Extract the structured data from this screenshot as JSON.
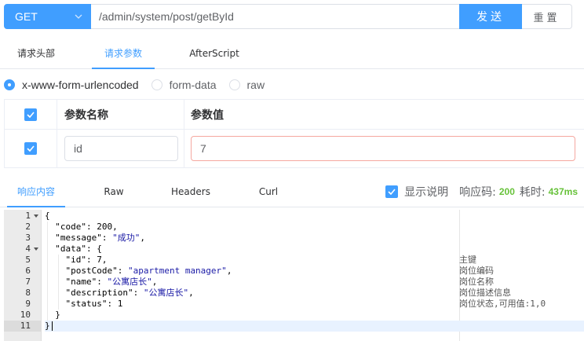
{
  "request": {
    "method": "GET",
    "url": "/admin/system/post/getById",
    "send_label": "发送",
    "reset_label": "重置"
  },
  "request_tabs": [
    {
      "label": "请求头部",
      "active": false
    },
    {
      "label": "请求参数",
      "active": true
    },
    {
      "label": "AfterScript",
      "active": false
    }
  ],
  "content_types": [
    {
      "label": "x-www-form-urlencoded",
      "checked": true
    },
    {
      "label": "form-data",
      "checked": false
    },
    {
      "label": "raw",
      "checked": false
    }
  ],
  "params_table": {
    "headers": [
      "参数名称",
      "参数值"
    ],
    "rows": [
      {
        "checked": true,
        "name": "id",
        "value": "7"
      }
    ]
  },
  "response_tabs": [
    {
      "label": "响应内容",
      "active": true
    },
    {
      "label": "Raw",
      "active": false
    },
    {
      "label": "Headers",
      "active": false
    },
    {
      "label": "Curl",
      "active": false
    }
  ],
  "response_meta": {
    "show_description_label": "显示说明",
    "show_description_checked": true,
    "status_label": "响应码:",
    "status_value": "200",
    "time_label": "耗时:",
    "time_value": "437ms"
  },
  "code_lines": [
    {
      "n": "1",
      "fold": true,
      "text": "{"
    },
    {
      "n": "2",
      "fold": false,
      "text": "  \"code\": 200,"
    },
    {
      "n": "3",
      "fold": false,
      "text": "  \"message\": \"成功\","
    },
    {
      "n": "4",
      "fold": true,
      "text": "  \"data\": {"
    },
    {
      "n": "5",
      "fold": false,
      "text": "    \"id\": 7,"
    },
    {
      "n": "6",
      "fold": false,
      "text": "    \"postCode\": \"apartment manager\","
    },
    {
      "n": "7",
      "fold": false,
      "text": "    \"name\": \"公寓店长\","
    },
    {
      "n": "8",
      "fold": false,
      "text": "    \"description\": \"公寓店长\","
    },
    {
      "n": "9",
      "fold": false,
      "text": "    \"status\": 1"
    },
    {
      "n": "10",
      "fold": false,
      "text": "  }"
    },
    {
      "n": "11",
      "fold": false,
      "text": "}"
    }
  ],
  "code_comments": [
    {
      "line": 5,
      "text": "主键"
    },
    {
      "line": 6,
      "text": "岗位编码"
    },
    {
      "line": 7,
      "text": "岗位名称"
    },
    {
      "line": 8,
      "text": "岗位描述信息"
    },
    {
      "line": 9,
      "text": "岗位状态,可用值:1,0"
    }
  ],
  "colors": {
    "accent": "#409eff",
    "success": "#67c23a",
    "string": "#1a1aa6"
  }
}
